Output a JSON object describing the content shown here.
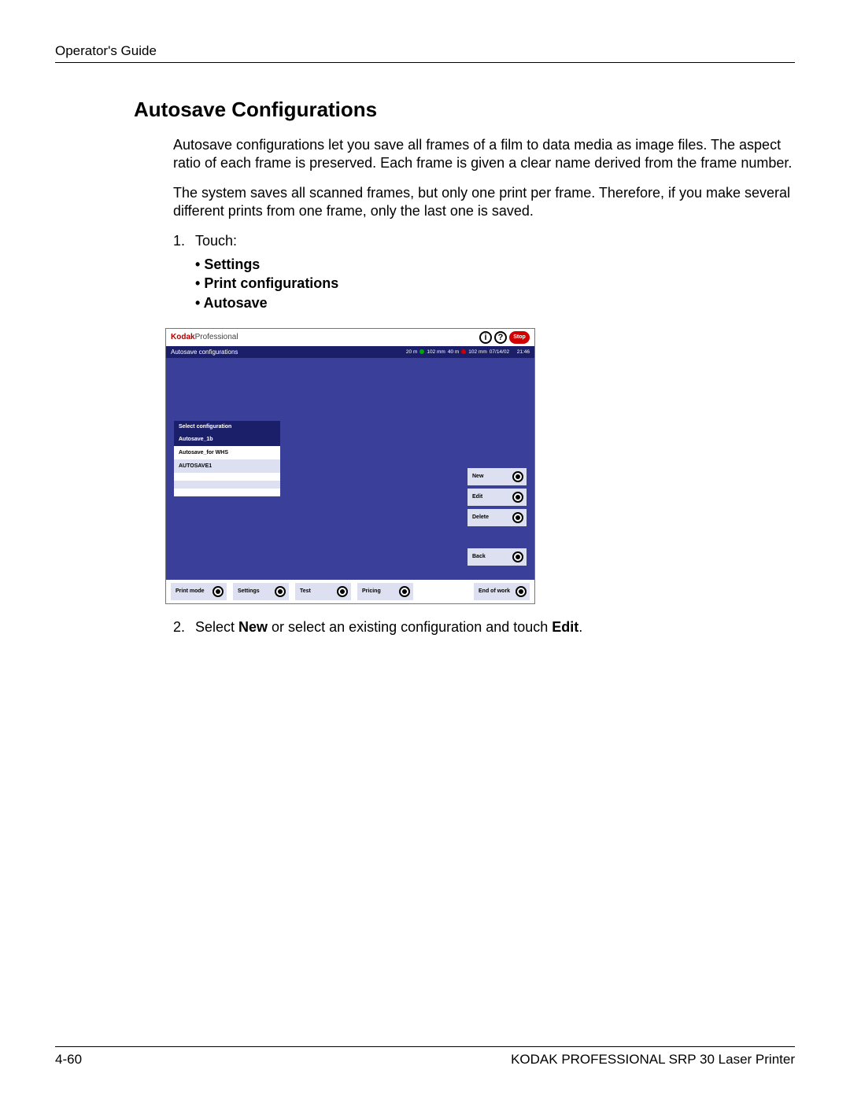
{
  "header": "Operator's Guide",
  "title": "Autosave Configurations",
  "para1": "Autosave configurations let you save all frames of a film to data media as image files. The aspect ratio of each frame is preserved. Each frame is given a clear name derived from the frame number.",
  "para2": "The system saves all scanned frames, but only one print per frame. Therefore, if you make several different prints from one frame, only the last one is saved.",
  "step1_label": "1.",
  "step1_text": "Touch:",
  "bullets": {
    "b1": "Settings",
    "b2": "Print configurations",
    "b3": "Autosave"
  },
  "screenshot": {
    "brand_kodak": "Kodak",
    "brand_pro": "Professional",
    "info_char": "i",
    "help_char": "?",
    "stop_label": "Stop",
    "titlebar": "Autosave configurations",
    "status_a": "20 m",
    "status_b": "102 mm",
    "status_c": "40 m",
    "status_d": "102 mm",
    "status_date": "07/14/02",
    "status_time": "21:46",
    "list_header": "Select configuration",
    "rows": {
      "r0": "Autosave_1b",
      "r1": "Autosave_for WHS",
      "r2": "AUTOSAVE1",
      "r3": "",
      "r4": "",
      "r5": ""
    },
    "side": {
      "new": "New",
      "edit": "Edit",
      "delete": "Delete",
      "back": "Back"
    },
    "footer": {
      "f0": "Print mode",
      "f1": "Settings",
      "f2": "Test",
      "f3": "Pricing",
      "f4": "End of work"
    }
  },
  "step2_label": "2.",
  "step2_pre": "Select ",
  "step2_bold1": "New",
  "step2_mid": " or select an existing configuration and touch ",
  "step2_bold2": "Edit",
  "step2_end": ".",
  "footer_left": "4-60",
  "footer_right": "KODAK PROFESSIONAL SRP 30 Laser Printer"
}
